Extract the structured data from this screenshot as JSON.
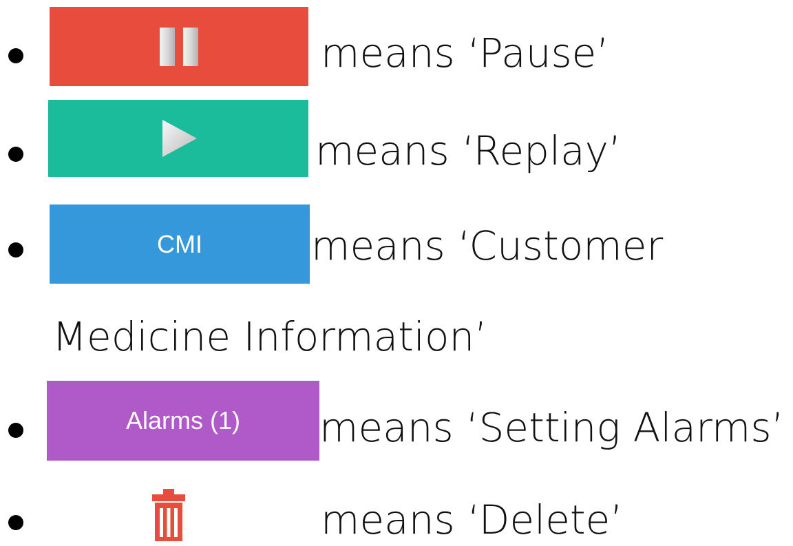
{
  "legend": {
    "items": [
      {
        "icon": "pause-icon",
        "button_color": "#E84C3D",
        "caption": "means ‘Pause’"
      },
      {
        "icon": "play-icon",
        "button_color": "#1BBC9B",
        "caption": "means ‘Replay’"
      },
      {
        "icon": "text-button",
        "button_label": "CMI",
        "button_color": "#3498DB",
        "caption": "means ‘Customer",
        "caption_line2": "Medicine Information’"
      },
      {
        "icon": "text-button",
        "button_label": "Alarms (1)",
        "button_color": "#AF5AC8",
        "caption": "means ‘Setting Alarms’"
      },
      {
        "icon": "trash-icon",
        "icon_color": "#E84C3D",
        "caption": "means ‘Delete’"
      }
    ]
  }
}
